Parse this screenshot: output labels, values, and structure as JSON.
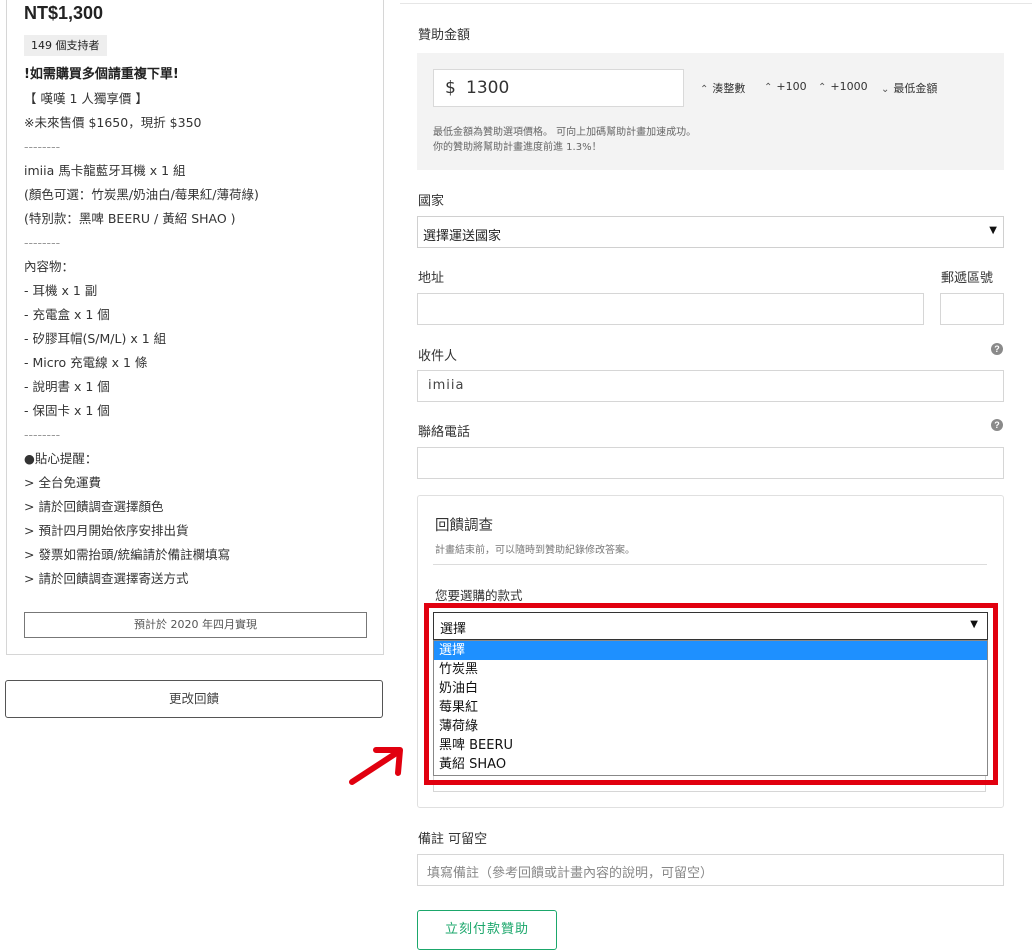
{
  "reward": {
    "price": "NT$1,300",
    "backers": "149 個支持者",
    "lines": [
      "!如需購買多個請重複下單!",
      "【 嘆嘆 1 人獨享價 】",
      "※未來售價 $1650，現折 $350",
      "--------",
      "imiia 馬卡龍藍牙耳機 x 1 組",
      "(顏色可選：竹炭黑/奶油白/莓果紅/薄荷綠)",
      "(特別款：黑啤 BEERU / 黃紹 SHAO )",
      "--------",
      "內容物：",
      "- 耳機 x 1 副",
      "- 充電盒 x 1 個",
      "- 矽膠耳帽(S/M/L) x 1 組",
      "- Micro 充電線 x 1 條",
      "- 說明書 x 1 個",
      "- 保固卡 x 1 個",
      "--------",
      "●貼心提醒：",
      "> 全台免運費",
      "> 請於回饋調查選擇顏色",
      "> 預計四月開始依序安排出貨",
      "> 發票如需抬頭/統編請於備註欄填寫",
      "> 請於回饋調查選擇寄送方式"
    ],
    "delivery": "預計於 2020 年四月實現",
    "change_button": "更改回饋"
  },
  "form": {
    "amount_label": "贊助金額",
    "currency": "$",
    "amount_value": "1300",
    "adjust_buttons": [
      "湊整數",
      "+100",
      "+1000",
      "最低金額"
    ],
    "amount_hint_1": "最低金額為贊助選項價格。 可向上加碼幫助計畫加速成功。",
    "amount_hint_2": "你的贊助將幫助計畫進度前進 1.3%！",
    "country_label": "國家",
    "country_value": "選擇運送國家",
    "address_label": "地址",
    "postal_label": "郵遞區號",
    "recipient_label": "收件人",
    "recipient_value": "imiia",
    "phone_label": "聯絡電話",
    "survey": {
      "title": "回饋調查",
      "subtitle": "計畫結束前，可以隨時到贊助紀錄修改答案。",
      "question": "您要選購的款式",
      "selected": "選擇",
      "options": [
        "選擇",
        "竹炭黑",
        "奶油白",
        "莓果紅",
        "薄荷綠",
        "黑啤 BEERU",
        "黃紹 SHAO"
      ]
    },
    "note_label": "備註 可留空",
    "note_placeholder": "填寫備註（參考回饋或計畫內容的說明，可留空）",
    "submit_button": "立刻付款贊助"
  },
  "colors": {
    "highlight": "#e1000f",
    "selected_option": "#1e90ff",
    "submit": "#1ba76b"
  }
}
